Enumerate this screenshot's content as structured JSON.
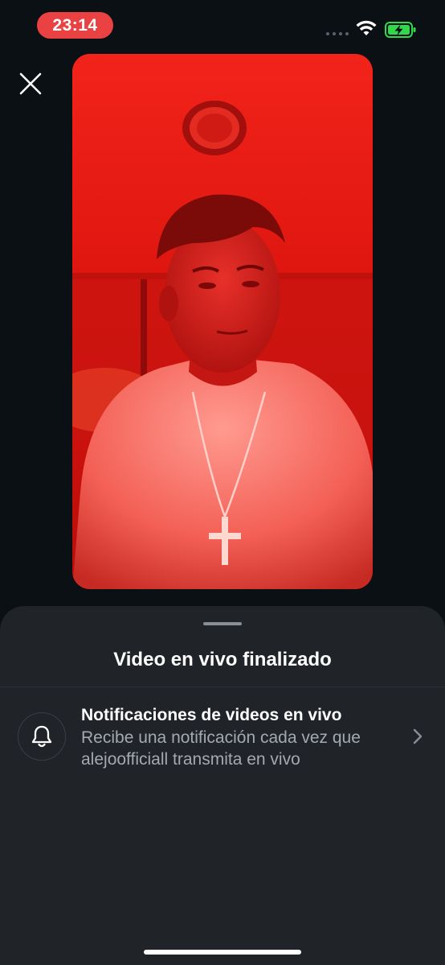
{
  "status_bar": {
    "time": "23:14",
    "icons": [
      "signal-dots-icon",
      "wifi-icon",
      "battery-charging-icon"
    ],
    "time_pill_color": "#ea4242",
    "battery_color": "#32d74b"
  },
  "header": {
    "close_icon": "close-icon"
  },
  "video_preview": {
    "dominant_color": "#e41812"
  },
  "sheet": {
    "title": "Video en vivo finalizado",
    "notification_row": {
      "icon": "bell-icon",
      "title": "Notificaciones de videos en vivo",
      "description": "Recibe una notificación cada vez que alejoofficiall transmita en vivo",
      "trailing_icon": "chevron-right-icon"
    }
  }
}
